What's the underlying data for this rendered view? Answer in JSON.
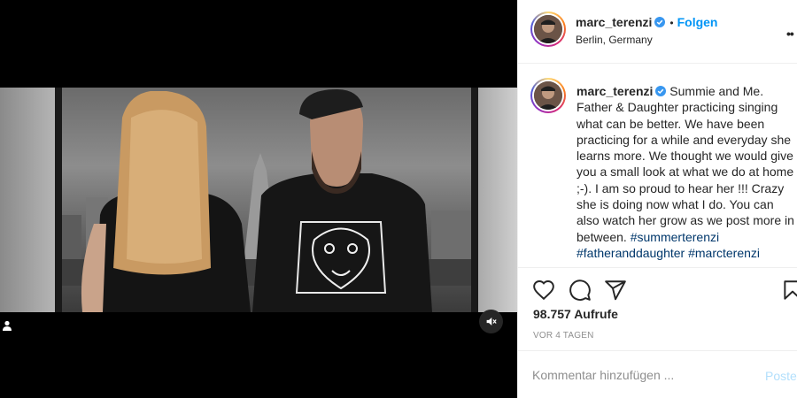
{
  "post": {
    "username": "marc_terenzi",
    "follow_label": "Folgen",
    "dot": "•",
    "location": "Berlin, Germany",
    "more": "••"
  },
  "caption": {
    "username": "marc_terenzi",
    "text": "Summie and Me. Father & Daughter practicing singing what can be better. We have been practicing for a while and everyday she learns more. We thought we would give you a small look at what we do at home ;-). I am so proud to hear her !!! Crazy she is doing now what I do. You can also watch her grow as we post more in between. ",
    "hashtags": [
      "#summerterenzi",
      "#fatheranddaughter",
      "#marcterenzi"
    ]
  },
  "stats": {
    "views": "98.757 Aufrufe",
    "timestamp": "VOR 4 TAGEN"
  },
  "comment": {
    "placeholder": "Kommentar hinzufügen ...",
    "post_label": "Posten"
  },
  "icons": {
    "like": "heart-icon",
    "comment": "comment-icon",
    "share": "share-icon",
    "save": "bookmark-icon",
    "mute": "muted-speaker-icon",
    "user_tag": "user-icon",
    "verified": "verified-badge-icon"
  },
  "colors": {
    "accent": "#0095f6",
    "verified": "#3897f0",
    "hashtag": "#00376b",
    "muted_text": "#8e8e8e"
  }
}
